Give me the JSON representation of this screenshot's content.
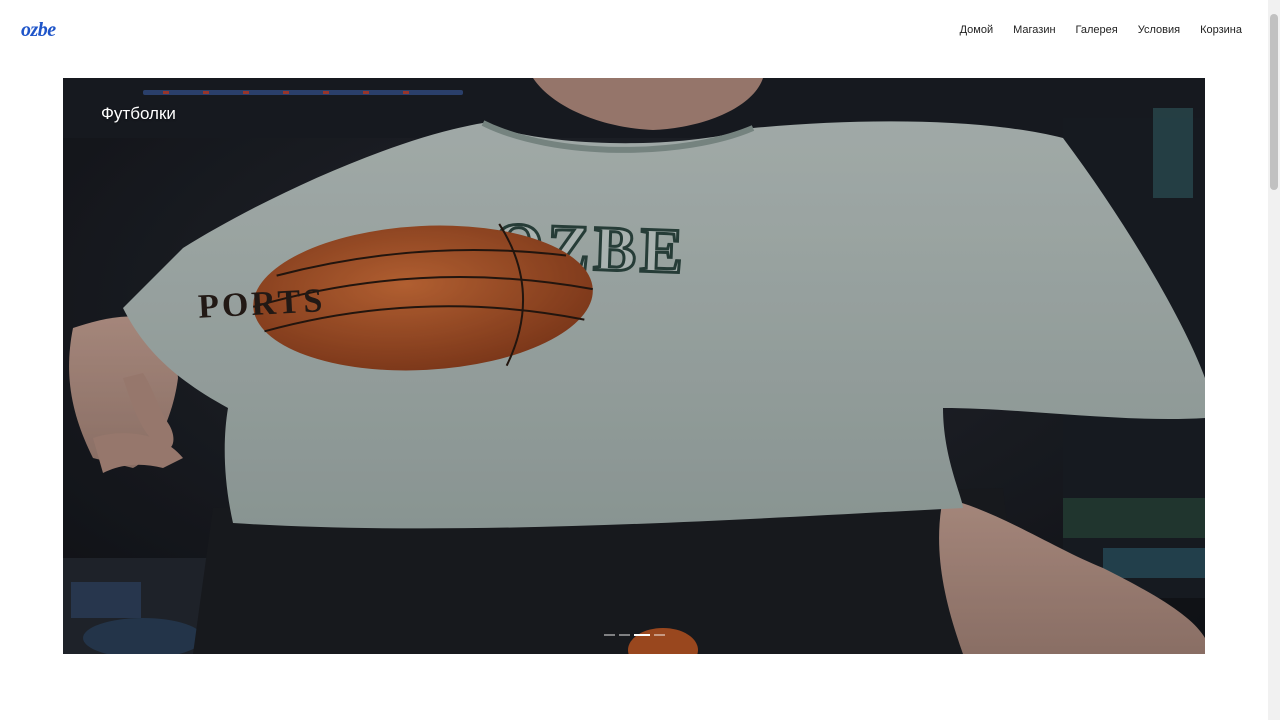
{
  "brand": {
    "logo_text": "ozbe",
    "accent": "#1f55c9"
  },
  "nav": {
    "items": [
      {
        "label": "Домой"
      },
      {
        "label": "Магазин"
      },
      {
        "label": "Галерея"
      },
      {
        "label": "Условия"
      },
      {
        "label": "Корзина"
      }
    ]
  },
  "hero": {
    "title": "Футболки",
    "shirt_print": "OZBE",
    "ball_print": "PORTS",
    "slide_count": 4,
    "active_slide": 3
  }
}
